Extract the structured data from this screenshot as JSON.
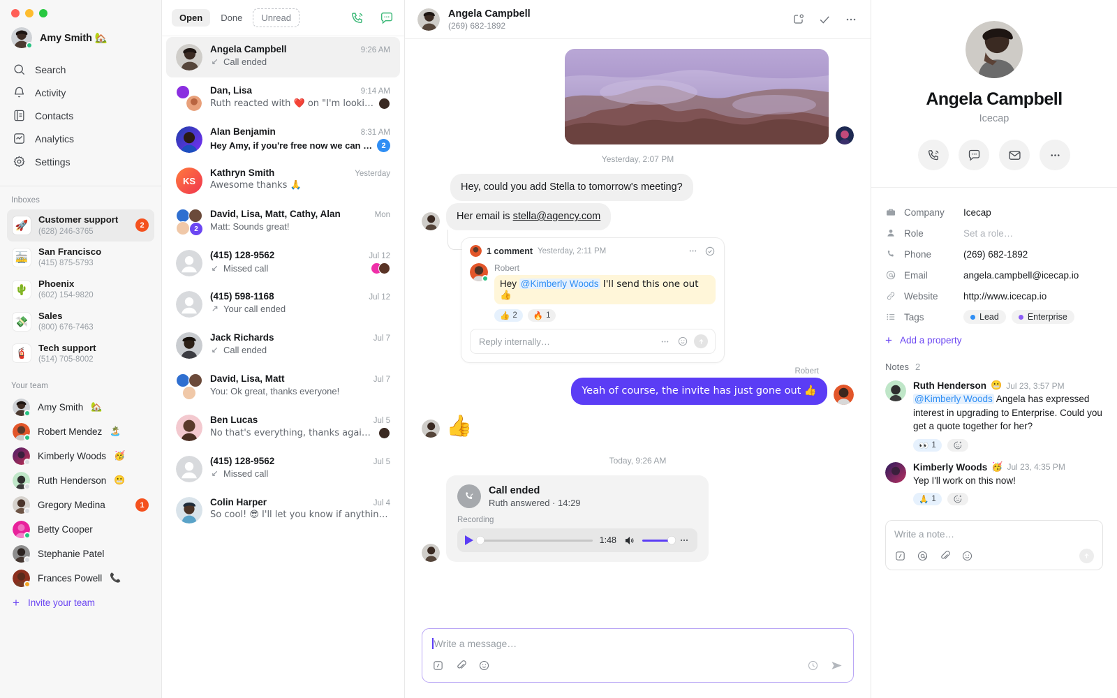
{
  "window": {
    "traffic_lights": [
      "close",
      "minimize",
      "maximize"
    ]
  },
  "sidebar": {
    "user": {
      "name": "Amy Smith",
      "emoji": "🏡",
      "status": "online"
    },
    "nav": [
      {
        "label": "Search",
        "icon": "search-icon"
      },
      {
        "label": "Activity",
        "icon": "bell-icon"
      },
      {
        "label": "Contacts",
        "icon": "contacts-icon"
      },
      {
        "label": "Analytics",
        "icon": "analytics-icon"
      },
      {
        "label": "Settings",
        "icon": "gear-icon"
      }
    ],
    "inboxes_title": "Inboxes",
    "inboxes": [
      {
        "name": "Customer support",
        "number": "(628) 246-3765",
        "emoji": "🚀",
        "badge": "2",
        "active": true
      },
      {
        "name": "San Francisco",
        "number": "(415) 875-5793",
        "emoji": "🚋",
        "badge": "",
        "active": false
      },
      {
        "name": "Phoenix",
        "number": "(602) 154-9820",
        "emoji": "🌵",
        "badge": "",
        "active": false
      },
      {
        "name": "Sales",
        "number": "(800) 676-7463",
        "emoji": "💸",
        "badge": "",
        "active": false
      },
      {
        "name": "Tech support",
        "number": "(514) 705-8002",
        "emoji": "🧯",
        "badge": "",
        "active": false
      }
    ],
    "team_title": "Your team",
    "team": [
      {
        "name": "Amy Smith",
        "emoji": "🏡",
        "status": "online",
        "badge": ""
      },
      {
        "name": "Robert Mendez",
        "emoji": "🏝️",
        "status": "online",
        "badge": ""
      },
      {
        "name": "Kimberly Woods",
        "emoji": "🥳",
        "status": "away",
        "badge": ""
      },
      {
        "name": "Ruth Henderson",
        "emoji": "😬",
        "status": "away",
        "badge": ""
      },
      {
        "name": "Gregory Medina",
        "emoji": "",
        "status": "offline",
        "badge": "1"
      },
      {
        "name": "Betty Cooper",
        "emoji": "",
        "status": "online",
        "badge": ""
      },
      {
        "name": "Stephanie Patel",
        "emoji": "",
        "status": "away",
        "badge": ""
      },
      {
        "name": "Frances Powell",
        "emoji": "📞",
        "status": "orange",
        "badge": ""
      }
    ],
    "invite_label": "Invite your team"
  },
  "conversation_list": {
    "filters": [
      {
        "label": "Open",
        "state": "selected"
      },
      {
        "label": "Done",
        "state": "normal"
      },
      {
        "label": "Unread",
        "state": "dashed"
      }
    ],
    "actions": [
      {
        "name": "new-call-icon"
      },
      {
        "name": "new-message-icon"
      }
    ],
    "items": [
      {
        "name": "Angela Campbell",
        "time": "9:26 AM",
        "preview": "Call ended",
        "call_icon": "call-ended-in",
        "badge": "",
        "unread": false,
        "selected": true
      },
      {
        "name": "Dan, Lisa",
        "time": "9:14 AM",
        "preview": "Ruth reacted with ❤️ on \"I'm looking fo…",
        "call_icon": "",
        "badge": "",
        "unread": false,
        "selected": false,
        "trailing_emoji": "🧑🏽"
      },
      {
        "name": "Alan Benjamin",
        "time": "8:31 AM",
        "preview": "Hey Amy, if you're free now we can ju…",
        "call_icon": "",
        "badge": "2",
        "unread": true,
        "selected": false
      },
      {
        "name": "Kathryn Smith",
        "time": "Yesterday",
        "preview": "Awesome thanks 🙏",
        "call_icon": "",
        "badge": "",
        "unread": false,
        "selected": false
      },
      {
        "name": "David, Lisa, Matt, Cathy, Alan",
        "time": "Mon",
        "preview": "Matt: Sounds great!",
        "call_icon": "",
        "badge": "",
        "group": true,
        "group_count": "2",
        "unread": false,
        "selected": false
      },
      {
        "name": "(415) 128-9562",
        "time": "Jul 12",
        "preview": "Missed call",
        "call_icon": "call-missed",
        "badge": "",
        "unread": false,
        "selected": false,
        "avatars": 2
      },
      {
        "name": "(415) 598-1168",
        "time": "Jul 12",
        "preview": "Your call ended",
        "call_icon": "call-out",
        "badge": "",
        "unread": false,
        "selected": false
      },
      {
        "name": "Jack Richards",
        "time": "Jul 7",
        "preview": "Call ended",
        "call_icon": "call-ended-in",
        "badge": "",
        "unread": false,
        "selected": false
      },
      {
        "name": "David, Lisa, Matt",
        "time": "Jul 7",
        "preview": "You: Ok great, thanks everyone!",
        "call_icon": "",
        "badge": "",
        "group": true,
        "unread": false,
        "selected": false
      },
      {
        "name": "Ben Lucas",
        "time": "Jul 5",
        "preview": "No that's everything, thanks again! 👌",
        "call_icon": "",
        "badge": "",
        "unread": false,
        "selected": false,
        "avatars": 1
      },
      {
        "name": "(415) 128-9562",
        "time": "Jul 5",
        "preview": "Missed call",
        "call_icon": "call-missed",
        "badge": "",
        "unread": false,
        "selected": false
      },
      {
        "name": "Colin Harper",
        "time": "Jul 4",
        "preview": "So cool! 😎 I'll let you know if anything els…",
        "call_icon": "",
        "badge": "",
        "unread": false,
        "selected": false
      }
    ]
  },
  "thread": {
    "header": {
      "name": "Angela Campbell",
      "phone": "(269) 682-1892",
      "actions": [
        "snooze-icon",
        "check-icon",
        "more-icon"
      ]
    },
    "daystamps": {
      "yesterday": "Yesterday, 2:07 PM",
      "today": "Today, 9:26 AM"
    },
    "messages": [
      {
        "type": "image",
        "side": "in",
        "alt": "purple seascape rocks photo"
      },
      {
        "type": "text",
        "side": "in",
        "text": "Hey, could you add Stella to tomorrow's meeting?"
      },
      {
        "type": "text",
        "side": "in",
        "text": "Her email is ",
        "link": "stella@agency.com"
      }
    ],
    "internal_note": {
      "title": "1 comment",
      "time": "Yesterday, 2:11 PM",
      "author": "Robert",
      "text_before": "Hey ",
      "mention": "@Kimberly Woods",
      "text_after": " I'll send this one out 👍",
      "reactions": [
        {
          "emoji": "👍",
          "count": "2",
          "highlight": true
        },
        {
          "emoji": "🔥",
          "count": "1",
          "highlight": false
        }
      ],
      "reply_placeholder": "Reply internally…",
      "actions": [
        "more-icon",
        "emoji-icon",
        "send-icon"
      ]
    },
    "outgoing": {
      "sender": "Robert",
      "text": "Yeah of course, the invite has just gone out 👍"
    },
    "reaction_message": {
      "emoji": "👍"
    },
    "call_card": {
      "title": "Call ended",
      "subtitle": "Ruth answered · 14:29",
      "recording_label": "Recording",
      "duration": "1:48",
      "progress": 0,
      "volume": 100
    },
    "composer": {
      "placeholder": "Write a message…",
      "tools": [
        "snippet-icon",
        "attachment-icon",
        "emoji-icon"
      ],
      "right_tools": [
        "schedule-icon",
        "send-icon"
      ]
    }
  },
  "contact_panel": {
    "name": "Angela Campbell",
    "company_sub": "Icecap",
    "actions": [
      "call-icon",
      "message-icon",
      "email-icon",
      "more-icon"
    ],
    "properties": [
      {
        "icon": "briefcase-icon",
        "label": "Company",
        "value": "Icecap",
        "muted": false
      },
      {
        "icon": "person-icon",
        "label": "Role",
        "value": "Set a role…",
        "muted": true
      },
      {
        "icon": "phone-icon",
        "label": "Phone",
        "value": "(269) 682-1892",
        "muted": false
      },
      {
        "icon": "at-icon",
        "label": "Email",
        "value": "angela.campbell@icecap.io",
        "muted": false
      },
      {
        "icon": "link-icon",
        "label": "Website",
        "value": "http://www.icecap.io",
        "muted": false
      }
    ],
    "tags_label": "Tags",
    "tags": [
      {
        "label": "Lead",
        "color": "#2f8ef4"
      },
      {
        "label": "Enterprise",
        "color": "#8b5cf6"
      }
    ],
    "add_property": "Add a property",
    "notes_label": "Notes",
    "notes_count": "2",
    "notes": [
      {
        "author": "Ruth Henderson",
        "emoji": "😬",
        "time": "Jul 23, 3:57 PM",
        "mention": "@Kimberly Woods",
        "text": " Angela has expressed interest in upgrading to Enterprise. Could you get a quote together for her?",
        "reactions": [
          {
            "emoji": "👀",
            "count": "1",
            "highlight": true
          }
        ]
      },
      {
        "author": "Kimberly Woods",
        "emoji": "🥳",
        "time": "Jul 23, 4:35 PM",
        "mention": "",
        "text": "Yep I'll work on this now!",
        "reactions": [
          {
            "emoji": "🙏",
            "count": "1",
            "highlight": true
          }
        ]
      }
    ],
    "note_input": {
      "placeholder": "Write a note…",
      "tools": [
        "snippet-icon",
        "mention-icon",
        "attachment-icon",
        "emoji-icon"
      ],
      "send": "send-icon"
    }
  },
  "colors": {
    "accent": "#5b3df5",
    "badge_orange": "#f4511e",
    "badge_blue": "#2f8ef4",
    "green": "#3cb878",
    "link_purple": "#6b46f2"
  }
}
